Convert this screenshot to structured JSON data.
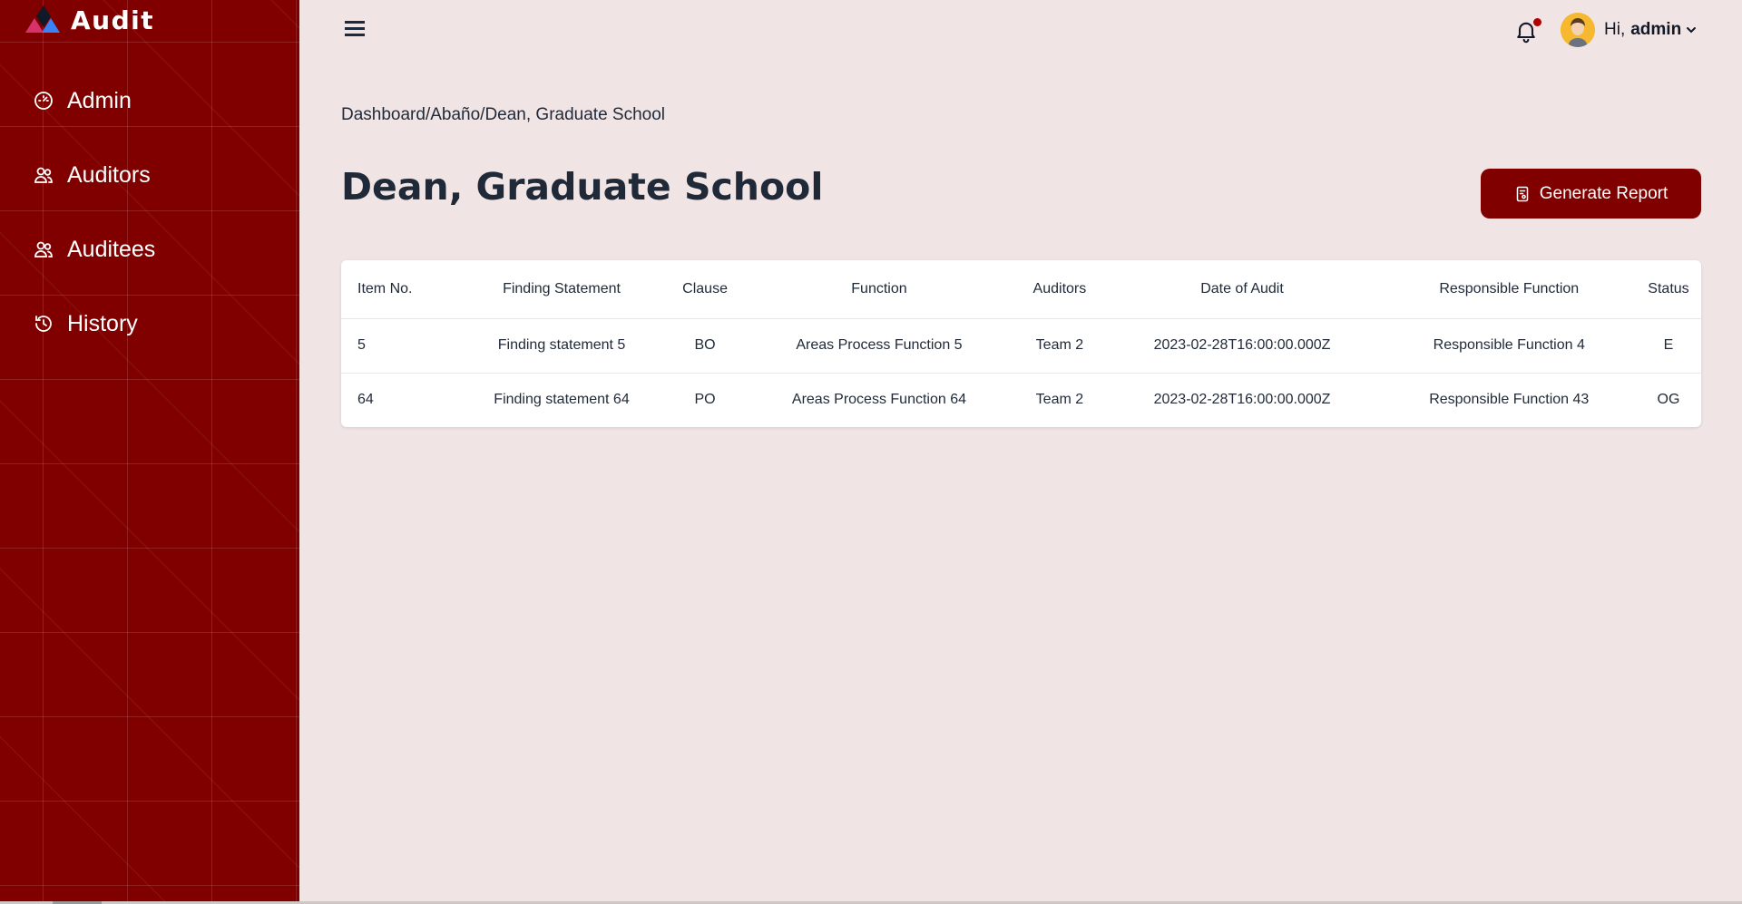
{
  "brand": {
    "name": "Audit"
  },
  "sidebar": {
    "items": [
      {
        "label": "Admin",
        "icon": "dashboard-gauge-icon"
      },
      {
        "label": "Auditors",
        "icon": "users-icon"
      },
      {
        "label": "Auditees",
        "icon": "users-icon"
      },
      {
        "label": "History",
        "icon": "history-clock-icon"
      }
    ]
  },
  "header": {
    "greeting": "Hi,",
    "username": "admin"
  },
  "breadcrumb": "Dashboard/Abaño/Dean, Graduate School",
  "page": {
    "title": "Dean, Graduate School",
    "generate_report_label": "Generate Report"
  },
  "table": {
    "columns": [
      "Item No.",
      "Finding Statement",
      "Clause",
      "Function",
      "Auditors",
      "Date of Audit",
      "Responsible Function",
      "Status"
    ],
    "rows": [
      [
        "5",
        "Finding statement 5",
        "BO",
        "Areas Process Function 5",
        "Team 2",
        "2023-02-28T16:00:00.000Z",
        "Responsible Function 4",
        "E"
      ],
      [
        "64",
        "Finding statement 64",
        "PO",
        "Areas Process Function 64",
        "Team 2",
        "2023-02-28T16:00:00.000Z",
        "Responsible Function 43",
        "OG"
      ]
    ]
  },
  "colors": {
    "accent": "#800000",
    "background": "#f1e4e4",
    "notification_dot": "#b00000"
  }
}
